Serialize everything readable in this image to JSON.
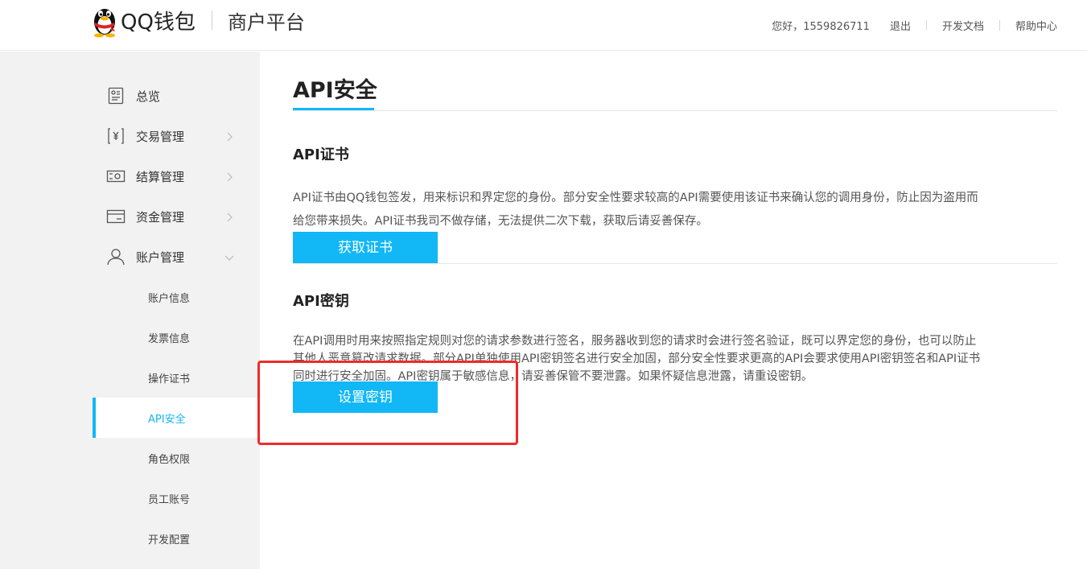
{
  "header": {
    "brand": "QQ钱包",
    "platform": "商户平台",
    "greeting": "您好，1559826711",
    "logout": "退出",
    "dev_docs": "开发文档",
    "help": "帮助中心"
  },
  "sidebar": {
    "menu": [
      {
        "label": "总览",
        "icon": "overview-icon"
      },
      {
        "label": "交易管理",
        "icon": "yen-receipt-icon"
      },
      {
        "label": "结算管理",
        "icon": "money-note-icon"
      },
      {
        "label": "资金管理",
        "icon": "card-icon"
      },
      {
        "label": "账户管理",
        "icon": "user-icon"
      }
    ],
    "sub": [
      {
        "label": "账户信息"
      },
      {
        "label": "发票信息"
      },
      {
        "label": "操作证书"
      },
      {
        "label": "API安全"
      },
      {
        "label": "角色权限"
      },
      {
        "label": "员工账号"
      },
      {
        "label": "开发配置"
      }
    ]
  },
  "main": {
    "title": "API安全",
    "cert": {
      "title": "API证书",
      "desc1": "API证书由QQ钱包签发，用来标识和界定您的身份。部分安全性要求较高的API需要使用该证书来确认您的调用身份，防止因为盗用而",
      "desc2": "给您带来损失。API证书我司不做存储，无法提供二次下载，获取后请妥善保存。",
      "button": "获取证书"
    },
    "key": {
      "title": "API密钥",
      "desc1": "在API调用时用来按照指定规则对您的请求参数进行签名，服务器收到您的请求时会进行签名验证，既可以界定您的身份，也可以防止",
      "desc2": "其他人恶意篡改请求数据。部分API单独使用API密钥签名进行安全加固，部分安全性要求更高的API会要求使用API密钥签名和API证书",
      "desc3": "同时进行安全加固。API密钥属于敏感信息，请妥善保管不要泄露。如果怀疑信息泄露，请重设密钥。",
      "button": "设置密钥"
    }
  },
  "colors": {
    "accent": "#12b7f5",
    "highlight": "#ef2b2b",
    "sidebar_bg": "#f2f2f2"
  }
}
